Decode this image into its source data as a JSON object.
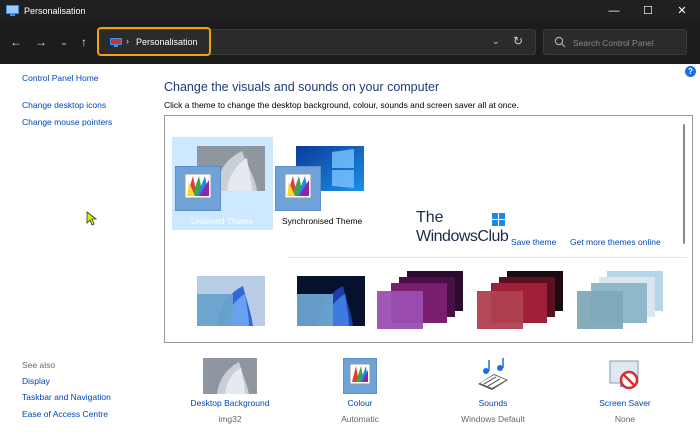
{
  "window": {
    "title": "Personalisation",
    "minimize_icon": "minimize-icon",
    "maximize_icon": "maximize-icon",
    "close_icon": "close-icon"
  },
  "nav": {
    "back_icon": "back-arrow-icon",
    "forward_icon": "forward-arrow-icon",
    "recent_icon": "chevron-down-icon",
    "up_icon": "up-arrow-icon",
    "breadcrumb_separator": "›",
    "breadcrumb": "Personalisation",
    "search_placeholder": "Search Control Panel"
  },
  "sidebar": {
    "home_link": "Control Panel Home",
    "links": [
      "Change desktop icons",
      "Change mouse pointers"
    ],
    "see_also_label": "See also",
    "see_also_links": [
      "Display",
      "Taskbar and Navigation",
      "Ease of Access Centre"
    ]
  },
  "main": {
    "title": "Change the visuals and sounds on your computer",
    "subtitle": "Click a theme to change the desktop background, colour, sounds and screen saver all at once.",
    "help": "?"
  },
  "themes_panel": {
    "my_themes": [
      {
        "name": "Unsaved Theme",
        "selected": true
      },
      {
        "name": "Synchronised Theme",
        "selected": false
      }
    ],
    "watermark": {
      "line1": "The",
      "line2": "WindowsClub"
    },
    "save_theme_link": "Save theme",
    "get_more_link": "Get more themes online",
    "builtin_themes_count_visible": 5
  },
  "bottom_bar": [
    {
      "label": "Desktop Background",
      "value": "img32",
      "icon": "desktop-background-icon"
    },
    {
      "label": "Colour",
      "value": "Automatic",
      "icon": "colour-palette-icon"
    },
    {
      "label": "Sounds",
      "value": "Windows Default",
      "icon": "sounds-icon"
    },
    {
      "label": "Screen Saver",
      "value": "None",
      "icon": "screen-saver-icon"
    }
  ],
  "colors": {
    "titlebar_bg": "#202020",
    "navbar_bg": "#1c1c1c",
    "address_highlight": "#f0a30a",
    "link": "#0046b8",
    "heading": "#1e3b78",
    "selected_theme_bg": "#cde8ff"
  }
}
